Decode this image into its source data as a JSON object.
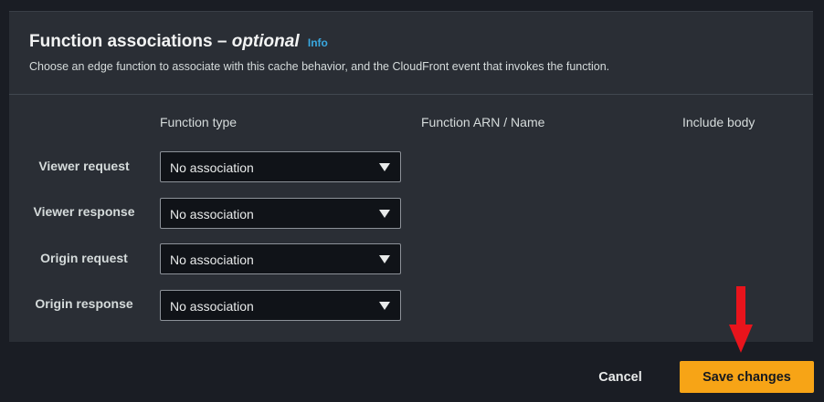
{
  "panel": {
    "title": "Function associations – ",
    "title_optional": "optional",
    "info_link": "Info",
    "description": "Choose an edge function to associate with this cache behavior, and the CloudFront event that invokes the function."
  },
  "columns": {
    "function_type": "Function type",
    "function_arn": "Function ARN / Name",
    "include_body": "Include body"
  },
  "rows": [
    {
      "label": "Viewer request",
      "selected": "No association"
    },
    {
      "label": "Viewer response",
      "selected": "No association"
    },
    {
      "label": "Origin request",
      "selected": "No association"
    },
    {
      "label": "Origin response",
      "selected": "No association"
    }
  ],
  "footer": {
    "cancel_label": "Cancel",
    "save_label": "Save changes"
  },
  "colors": {
    "background": "#1a1d24",
    "panel": "#2a2e35",
    "accent_button": "#f7a416",
    "info_link": "#39a8e0",
    "annotation_arrow": "#e8141c"
  },
  "icons": {
    "dropdown": "caret-down-icon",
    "annotation": "red-down-arrow-icon"
  }
}
